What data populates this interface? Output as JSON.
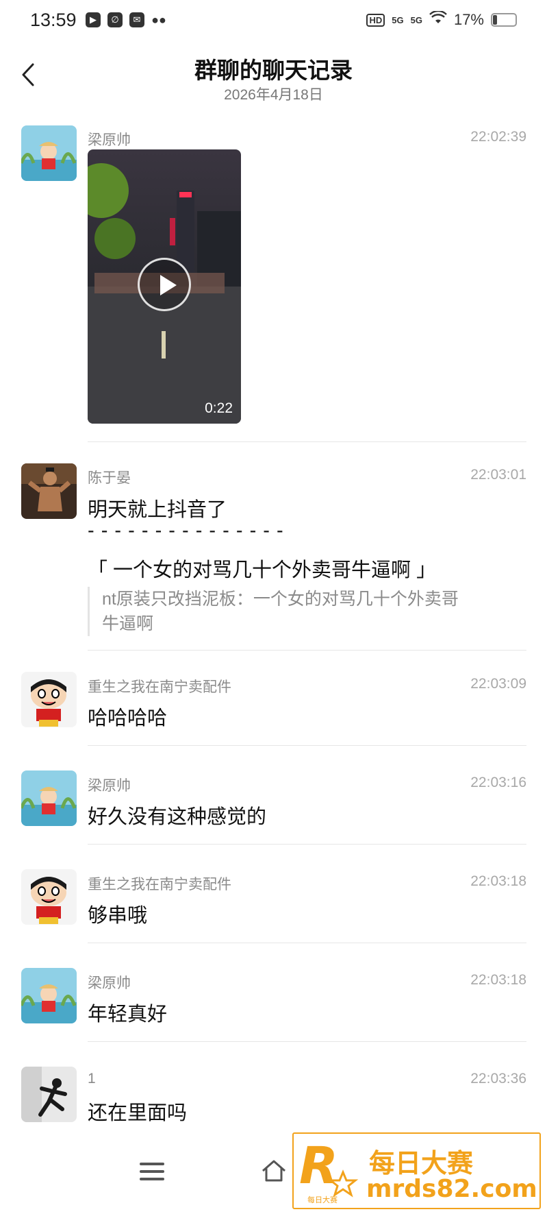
{
  "status_bar": {
    "time": "13:59",
    "battery": "17%",
    "battery_level": 0.17,
    "hd_label": "HD",
    "net1": "5G",
    "net2": "5G"
  },
  "header": {
    "title": "群聊的聊天记录",
    "date": "2026年4月18日"
  },
  "messages": [
    {
      "sender": "梁原帅",
      "time": "22:02:39",
      "video_duration": "0:22"
    },
    {
      "sender": "陈于晏",
      "time": "22:03:01",
      "text": "明天就上抖音了",
      "dashes": "- - - - - - - - - - - - - - -",
      "quote_title": "「 一个女的对骂几十个外卖哥牛逼啊 」",
      "quote_line1": "nt原装只改挡泥板：一个女的对骂几十个外卖哥",
      "quote_line2": "牛逼啊"
    },
    {
      "sender": "重生之我在南宁卖配件",
      "time": "22:03:09",
      "text": "哈哈哈哈"
    },
    {
      "sender": "梁原帅",
      "time": "22:03:16",
      "text": "好久没有这种感觉的"
    },
    {
      "sender": "重生之我在南宁卖配件",
      "time": "22:03:18",
      "text": "够串哦"
    },
    {
      "sender": "梁原帅",
      "time": "22:03:18",
      "text": "年轻真好"
    },
    {
      "sender": "1",
      "time": "22:03:36",
      "text": "还在里面吗"
    }
  ],
  "watermark": {
    "cn": "每日大赛",
    "url": "mrds82.com"
  },
  "colors": {
    "watermark": "#f2a21b",
    "time_text": "#a8a8a8",
    "sender_text": "#8a8a8a"
  }
}
